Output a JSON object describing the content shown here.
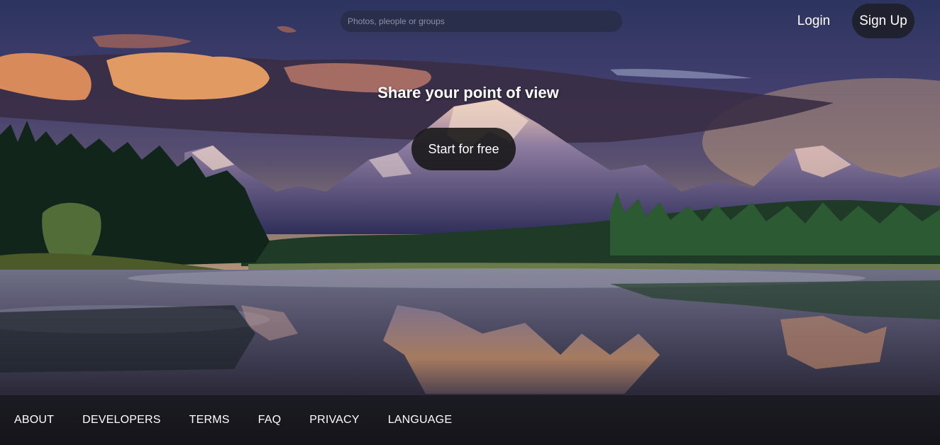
{
  "header": {
    "search_placeholder": "Photos, pleople or groups",
    "login_label": "Login",
    "signup_label": "Sign Up"
  },
  "hero": {
    "headline": "Share your point of view",
    "cta_label": "Start for free",
    "background": "mountain-lake-landscape"
  },
  "footer": {
    "links": [
      "ABOUT",
      "DEVELOPERS",
      "TERMS",
      "FAQ",
      "PRIVACY",
      "LANGUAGE"
    ]
  },
  "colors": {
    "sky_top": "#2d3460",
    "cloud_glow": "#d98a5a",
    "button_dark": "#1e1f2a"
  }
}
